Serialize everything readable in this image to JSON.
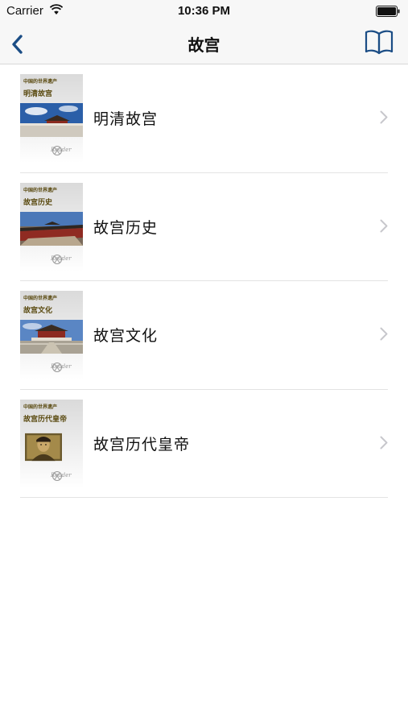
{
  "status_bar": {
    "carrier": "Carrier",
    "time": "10:36 PM"
  },
  "nav": {
    "title": "故宫"
  },
  "colors": {
    "accent": "#1b4d85",
    "chevron": "#c7c7cc"
  },
  "items": [
    {
      "cover_series": "中国的世界遗产",
      "cover_title": "明清故宫",
      "cover_brand": "Reader",
      "label": "明清故宫"
    },
    {
      "cover_series": "中国的世界遗产",
      "cover_title": "故宫历史",
      "cover_brand": "Reader",
      "label": "故宫历史"
    },
    {
      "cover_series": "中国的世界遗产",
      "cover_title": "故宫文化",
      "cover_brand": "Reader",
      "label": "故宫文化"
    },
    {
      "cover_series": "中国的世界遗产",
      "cover_title": "故宫历代皇帝",
      "cover_brand": "Reader",
      "label": "故宫历代皇帝"
    }
  ]
}
